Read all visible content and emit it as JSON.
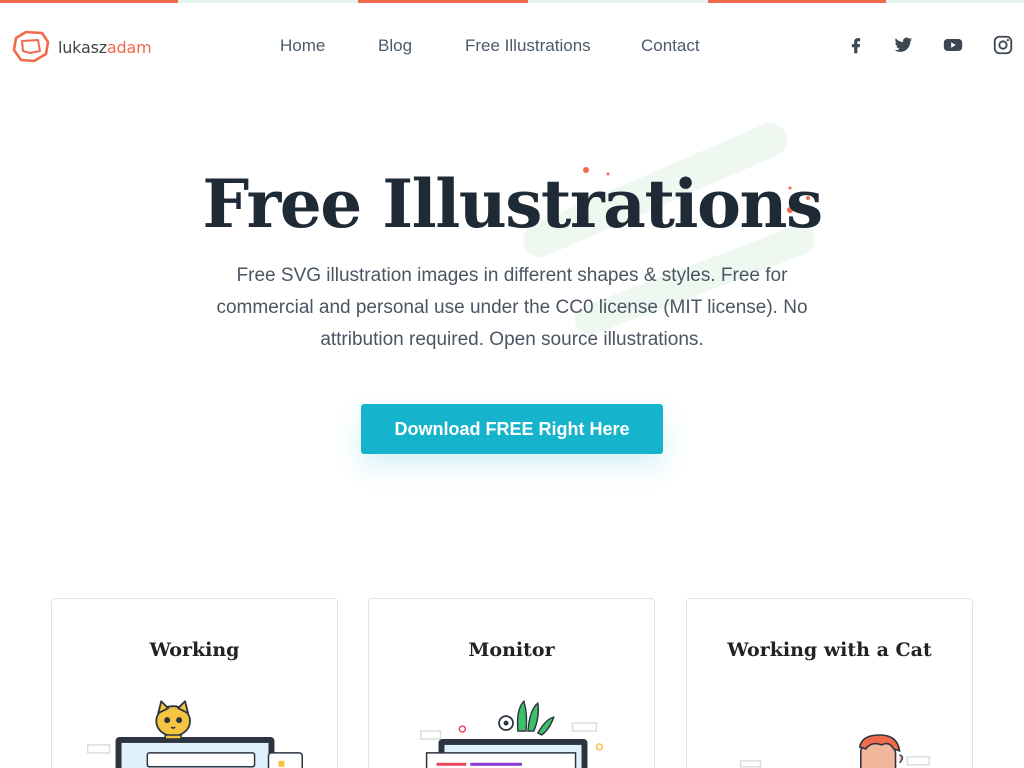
{
  "brand": {
    "name_part1": "lukasz",
    "name_part2": "adam",
    "accent_color": "#f26a4b"
  },
  "nav": {
    "home": "Home",
    "blog": "Blog",
    "free_illustrations": "Free Illustrations",
    "contact": "Contact"
  },
  "social": [
    "facebook-icon",
    "twitter-icon",
    "youtube-icon",
    "instagram-icon"
  ],
  "hero": {
    "title": "Free Illustrations",
    "subtitle": "Free SVG illustration images in different shapes & styles. Free for commercial and personal use under the CC0 license (MIT license). No attribution required. Open source illustrations.",
    "cta_label": "Download FREE Right Here",
    "cta_color": "#16b4cc"
  },
  "cards": [
    {
      "title": "Working"
    },
    {
      "title": "Monitor"
    },
    {
      "title": "Working with a Cat"
    }
  ]
}
